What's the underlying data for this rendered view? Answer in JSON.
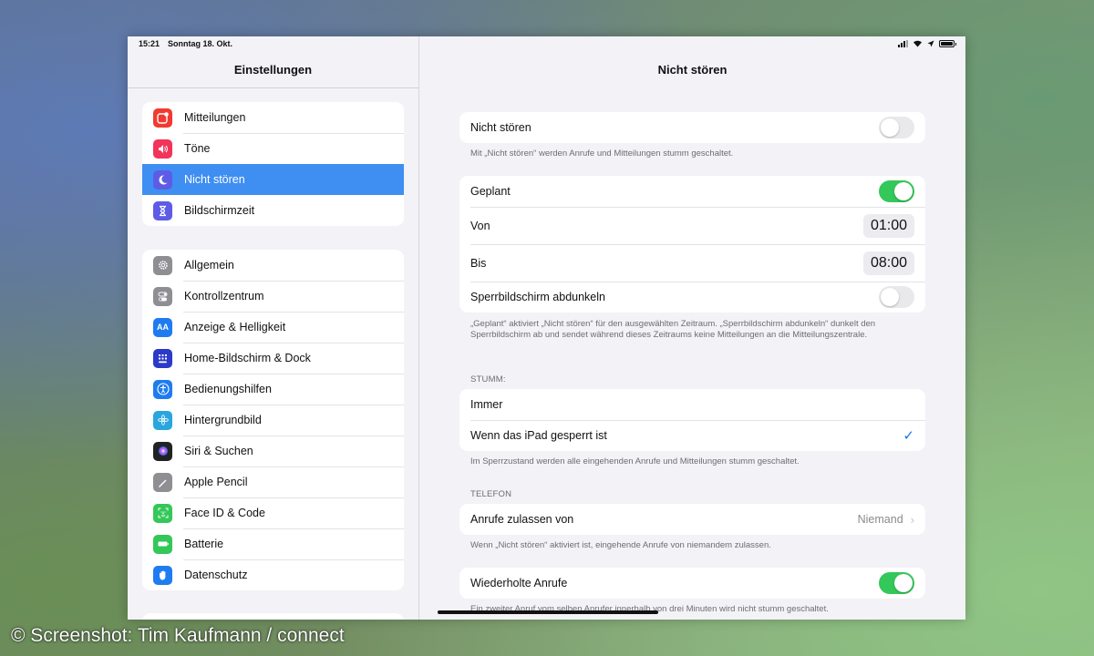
{
  "status": {
    "time": "15:21",
    "date": "Sonntag 18. Okt."
  },
  "sidebar": {
    "title": "Einstellungen",
    "group1": [
      {
        "label": "Mitteilungen",
        "icon": "notifications-icon",
        "color": "#f23a30"
      },
      {
        "label": "Töne",
        "icon": "speaker-icon",
        "color": "#f2345a"
      },
      {
        "label": "Nicht stören",
        "icon": "moon-icon",
        "color": "#5e5ce6",
        "selected": true
      },
      {
        "label": "Bildschirmzeit",
        "icon": "hourglass-icon",
        "color": "#5e5ce6"
      }
    ],
    "group2": [
      {
        "label": "Allgemein",
        "icon": "gear-icon",
        "color": "#8e8e93"
      },
      {
        "label": "Kontrollzentrum",
        "icon": "switches-icon",
        "color": "#8e8e93"
      },
      {
        "label": "Anzeige & Helligkeit",
        "icon": "text-size-icon",
        "color": "#1f7cf0"
      },
      {
        "label": "Home-Bildschirm & Dock",
        "icon": "grid-icon",
        "color": "#2c3ac8"
      },
      {
        "label": "Bedienungshilfen",
        "icon": "accessibility-icon",
        "color": "#1f7cf0"
      },
      {
        "label": "Hintergrundbild",
        "icon": "flower-icon",
        "color": "#2aa6de"
      },
      {
        "label": "Siri & Suchen",
        "icon": "siri-icon",
        "color": "#222222"
      },
      {
        "label": "Apple Pencil",
        "icon": "pencil-icon",
        "color": "#8e8e93"
      },
      {
        "label": "Face ID & Code",
        "icon": "face-id-icon",
        "color": "#34c759"
      },
      {
        "label": "Batterie",
        "icon": "battery-icon",
        "color": "#34c759"
      },
      {
        "label": "Datenschutz",
        "icon": "hand-icon",
        "color": "#1f7cf0"
      }
    ]
  },
  "detail": {
    "title": "Nicht stören",
    "dnd_label": "Nicht stören",
    "dnd_on": false,
    "dnd_footer": "Mit „Nicht stören“ werden Anrufe und Mitteilungen stumm geschaltet.",
    "scheduled_label": "Geplant",
    "scheduled_on": true,
    "from_label": "Von",
    "from_time": "01:00",
    "to_label": "Bis",
    "to_time": "08:00",
    "dim_label": "Sperrbildschirm abdunkeln",
    "dim_on": false,
    "scheduled_footer": "„Geplant“ aktiviert „Nicht stören“ für den ausgewählten Zeitraum. „Sperrbildschirm abdunkeln“ dunkelt den Sperrbildschirm ab und sendet während dieses Zeitraums keine Mitteilungen an die Mitteilungszentrale.",
    "silence_header": "STUMM:",
    "always_label": "Immer",
    "locked_label": "Wenn das iPad gesperrt ist",
    "silence_footer": "Im Sperrzustand werden alle eingehenden Anrufe und Mitteilungen stumm geschaltet.",
    "phone_header": "TELEFON",
    "allow_calls_label": "Anrufe zulassen von",
    "allow_calls_value": "Niemand",
    "phone_footer": "Wenn „Nicht stören“ aktiviert ist, eingehende Anrufe von niemandem zulassen.",
    "repeated_label": "Wiederholte Anrufe",
    "repeated_on": true,
    "repeated_footer": "Ein zweiter Anruf vom selben Anrufer innerhalb von drei Minuten wird nicht stumm geschaltet."
  },
  "credit": "© Screenshot: Tim Kaufmann / connect"
}
